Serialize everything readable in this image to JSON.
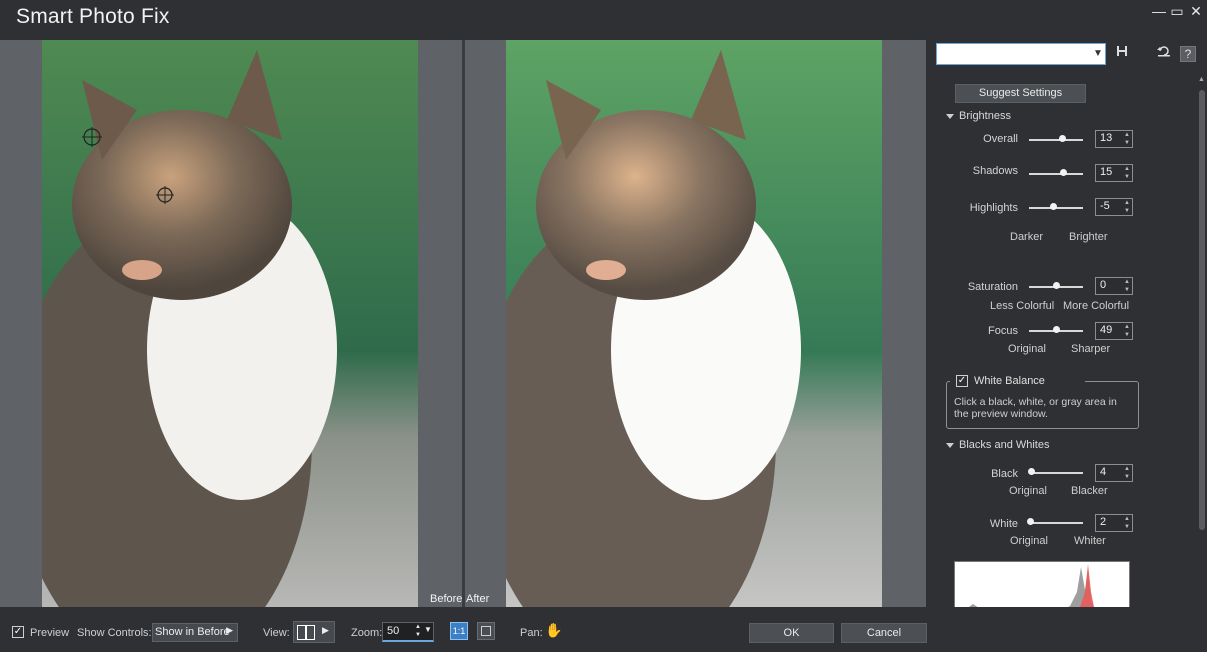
{
  "window": {
    "title": "Smart Photo Fix",
    "minimize_glyph": "—",
    "restore_glyph": "▭",
    "close_glyph": "✕"
  },
  "preview": {
    "before_label": "Before",
    "after_label": "After"
  },
  "panel": {
    "preset_combo_value": "",
    "suggest_button": "Suggest Settings",
    "brightness": {
      "header": "Brightness",
      "overall": {
        "label": "Overall",
        "value": "13",
        "level": 0.62
      },
      "shadows": {
        "label": "Shadows",
        "value": "15",
        "level": 0.64
      },
      "highlights": {
        "label": "Highlights",
        "value": "-5",
        "level": 0.45
      },
      "darker": "Darker",
      "brighter": "Brighter"
    },
    "saturation": {
      "label": "Saturation",
      "value": "0",
      "level": 0.5,
      "less": "Less Colorful",
      "more": "More Colorful"
    },
    "focus": {
      "label": "Focus",
      "value": "49",
      "level": 0.5,
      "original": "Original",
      "sharper": "Sharper"
    },
    "white_balance": {
      "label": "White Balance",
      "checked": true,
      "hint": "Click a black, white, or gray area in the preview window."
    },
    "blacks_whites": {
      "header": "Blacks and Whites",
      "black": {
        "label": "Black",
        "value": "4",
        "level": 0.04,
        "original": "Original",
        "blacker": "Blacker"
      },
      "white": {
        "label": "White",
        "value": "2",
        "level": 0.02,
        "original": "Original",
        "whiter": "Whiter"
      }
    }
  },
  "bottom": {
    "preview_label": "Preview",
    "preview_checked": true,
    "show_controls_label": "Show Controls:",
    "show_controls_value": "Show in Before",
    "view_label": "View:",
    "zoom_label": "Zoom:",
    "zoom_value": "50",
    "pan_label": "Pan:",
    "ok": "OK",
    "cancel": "Cancel"
  },
  "icons": {
    "save": "save-icon",
    "reset": "reset-icon",
    "help": "help-icon",
    "pan": "hand-icon"
  },
  "colors": {
    "bg": "#2e3033",
    "accent": "#6aa7dd",
    "histogram_red": "#e85a5a"
  }
}
